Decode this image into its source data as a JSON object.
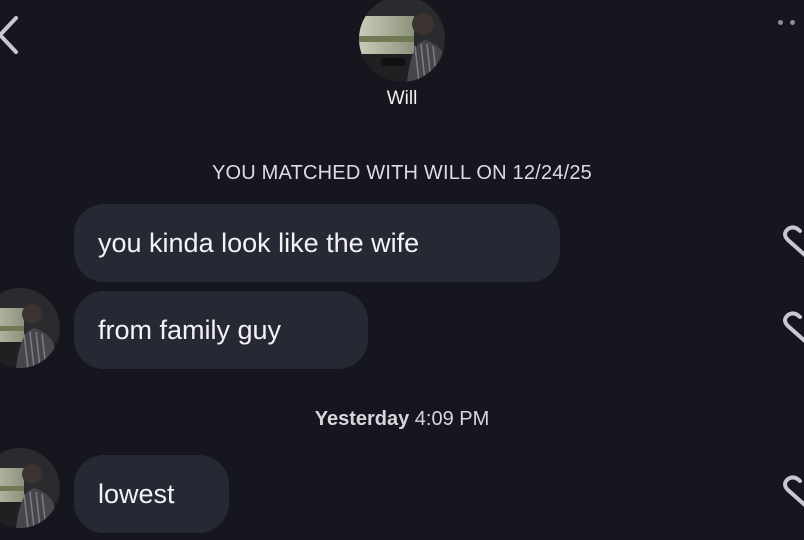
{
  "header": {
    "match_name": "Will",
    "back_icon": "chevron-left-icon",
    "more_icon": "more-dots-icon"
  },
  "chat": {
    "match_banner": "YOU MATCHED WITH WILL ON 12/24/25",
    "messages": [
      {
        "text": "you kinda look like the wife",
        "show_avatar": false
      },
      {
        "text": "from family guy",
        "show_avatar": true
      },
      {
        "text": "lowest",
        "show_avatar": true
      }
    ],
    "divider": {
      "day": "Yesterday",
      "time": "4:09 PM"
    }
  },
  "colors": {
    "background": "#15161e",
    "bubble": "#262833",
    "text": "#f3f3f6"
  }
}
